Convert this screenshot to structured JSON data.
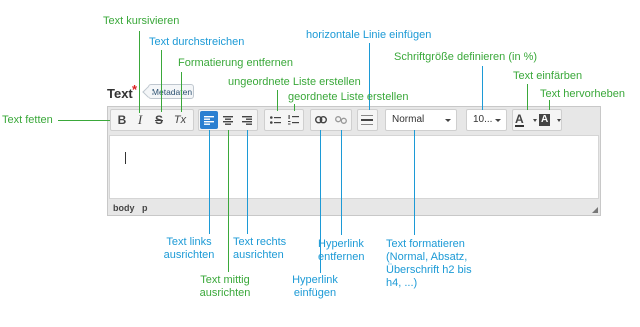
{
  "field": {
    "title": "Text",
    "required_marker": "*",
    "metadata_button": "Metadaten"
  },
  "toolbar": {
    "bold": "B",
    "italic": "I",
    "strike": "S",
    "clear": "Tx",
    "format_select": "Normal",
    "size_select": "10...",
    "text_color": "A",
    "highlight": "A"
  },
  "statusbar": {
    "path_body": "body",
    "path_p": "p"
  },
  "annotations": {
    "text_kursivieren": "Text kursivieren",
    "text_durchstreichen": "Text durchstreichen",
    "formatierung_entfernen": "Formatierung entfernen",
    "ungeordnete_liste": "ungeordnete Liste erstellen",
    "geordnete_liste": "geordnete Liste erstellen",
    "horizontale_linie": "horizontale Linie einfügen",
    "schriftgroesse": "Schriftgröße definieren (in %)",
    "text_einfaerben": "Text einfärben",
    "text_hervorheben": "Text hervorheben",
    "text_fetten": "Text fetten",
    "text_links_1": "Text links",
    "text_links_2": "ausrichten",
    "text_mittig_1": "Text mittig",
    "text_mittig_2": "ausrichten",
    "text_rechts_1": "Text rechts",
    "text_rechts_2": "ausrichten",
    "hyperlink_einfuegen_1": "Hyperlink",
    "hyperlink_einfuegen_2": "einfügen",
    "hyperlink_entfernen_1": "Hyperlink",
    "hyperlink_entfernen_2": "entfernen",
    "text_formatieren_1": "Text formatieren",
    "text_formatieren_2": "(Normal, Absatz,",
    "text_formatieren_3": "Überschrift h2 bis",
    "text_formatieren_4": "h4, ...)"
  },
  "colors": {
    "green_annotation": "#3aa83a",
    "blue_annotation": "#1c9ad6",
    "active_button": "#2a7fd1"
  }
}
